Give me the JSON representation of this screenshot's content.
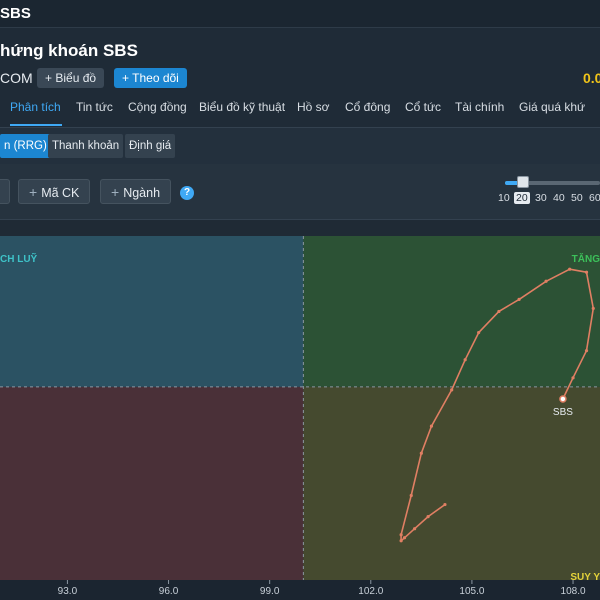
{
  "topbar": {
    "symbol": "SBS"
  },
  "header": {
    "title": "hứng khoán SBS",
    "exchange": "COM",
    "chart_button": "Biểu đồ",
    "follow_button": "Theo dõi",
    "price": "0.0",
    "price_color": "#f0c419"
  },
  "tabs": [
    {
      "label": "Phân tích",
      "active": true
    },
    {
      "label": "Tin tức"
    },
    {
      "label": "Cộng đồng"
    },
    {
      "label": "Biểu đồ kỹ thuật"
    },
    {
      "label": "Hồ sơ"
    },
    {
      "label": "Cổ đông"
    },
    {
      "label": "Cổ tức"
    },
    {
      "label": "Tài chính"
    },
    {
      "label": "Giá quá khứ"
    }
  ],
  "subtabs": [
    {
      "label": "n (RRG)",
      "active": true
    },
    {
      "label": "Thanh khoản"
    },
    {
      "label": "Định giá"
    }
  ],
  "toolbar": {
    "add_symbol": "Mã CK",
    "add_industry": "Ngành",
    "help": "?"
  },
  "periods": {
    "options": [
      "10",
      "20",
      "30",
      "40",
      "50",
      "60"
    ],
    "selected": "20",
    "slider_fraction": 0.1
  },
  "chart_data": {
    "type": "scatter",
    "quadrants": {
      "top_left": {
        "label": "CH LUỸ",
        "color": "#2b5263",
        "text_color": "#3ec2c8"
      },
      "top_right": {
        "label": "TĂNG",
        "color": "#2c5235",
        "text_color": "#3cc05a"
      },
      "bottom_left": {
        "label": "",
        "color": "#4a3038",
        "text_color": "#e0506a"
      },
      "bottom_right": {
        "label": "SUY Y",
        "color": "#454a2f",
        "text_color": "#e4d33a"
      }
    },
    "center": {
      "x": 100.0,
      "y": 100.0
    },
    "xlim": [
      91.0,
      108.8
    ],
    "x_ticks": [
      "93.0",
      "96.0",
      "99.0",
      "102.0",
      "105.0",
      "108.0"
    ],
    "x_tick_values": [
      93.0,
      96.0,
      99.0,
      102.0,
      105.0,
      108.0
    ],
    "ylim": [
      93.6,
      105.0
    ],
    "series": [
      {
        "label": "SBS",
        "color": "#e07f63",
        "x": [
          104.2,
          103.7,
          103.3,
          103.0,
          102.9,
          102.9,
          103.2,
          103.5,
          103.8,
          104.4,
          104.8,
          105.2,
          105.8,
          106.4,
          107.2,
          107.9,
          108.4,
          108.6,
          108.4,
          108.0,
          107.7
        ],
        "y": [
          96.1,
          95.7,
          95.3,
          95.0,
          94.9,
          95.1,
          96.4,
          97.8,
          98.7,
          99.9,
          100.9,
          101.8,
          102.5,
          102.9,
          103.5,
          103.9,
          103.8,
          102.6,
          101.2,
          100.3,
          99.6
        ]
      }
    ]
  }
}
